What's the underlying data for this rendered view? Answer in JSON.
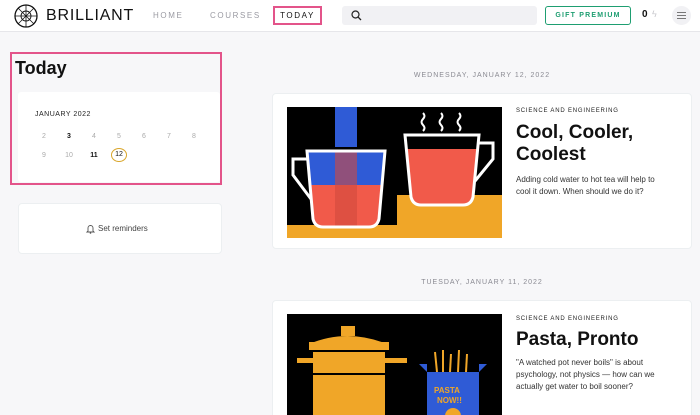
{
  "header": {
    "brand": "BRILLIANT",
    "nav": {
      "home": "HOME",
      "courses": "COURSES",
      "today": "TODAY"
    },
    "gift_label": "GIFT PREMIUM",
    "streak_count": "0"
  },
  "sidebar": {
    "title": "Today",
    "calendar": {
      "month": "JANUARY 2022",
      "row1": [
        "2",
        "3",
        "4",
        "5",
        "6",
        "7",
        "8"
      ],
      "row2": [
        "9",
        "10",
        "11",
        "12"
      ]
    },
    "reminders_label": "Set reminders"
  },
  "feed": [
    {
      "date": "WEDNESDAY, JANUARY 12, 2022",
      "category": "SCIENCE AND ENGINEERING",
      "title_line1": "Cool, Cooler,",
      "title_line2": "Coolest",
      "desc_line1": "Adding cold water to hot tea will help to",
      "desc_line2": "cool it down. When should we do it?"
    },
    {
      "date": "TUESDAY, JANUARY 11, 2022",
      "category": "SCIENCE AND ENGINEERING",
      "title_line1": "Pasta, Pronto",
      "desc_line1": "\"A watched pot never boils\" is about",
      "desc_line2": "psychology, not physics — how can we",
      "desc_line3": "actually get water to boil sooner?",
      "illustration_text_line1": "PASTA",
      "illustration_text_line2": "NOW!!"
    }
  ],
  "colors": {
    "accent_pink": "#e3548a",
    "premium_green": "#1e9e71",
    "current_day_ring": "#d9a62b",
    "illustration_orange": "#f0a628",
    "illustration_red": "#f15a4a",
    "illustration_blue": "#2f5bd6"
  }
}
